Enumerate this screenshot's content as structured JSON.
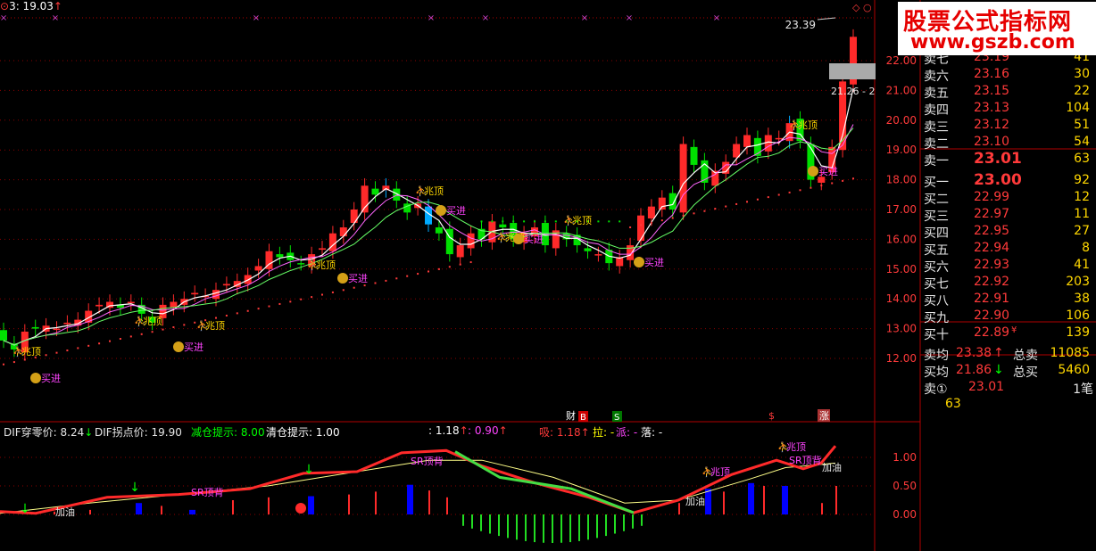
{
  "top": {
    "price_label": "3: 19.03",
    "up_arrow": "↑"
  },
  "chart": {
    "price_axis_labels": [
      "22.00",
      "21.00",
      "20.00",
      "19.00",
      "18.00",
      "17.00",
      "16.00",
      "15.00",
      "14.00",
      "13.00",
      "12.00"
    ],
    "osc_axis_labels": [
      "1.00",
      "0.50",
      "0.00"
    ],
    "high_label": "23.39",
    "range_label": "21.26 - 2",
    "markers": {
      "top": "兆顶",
      "buy": "买进",
      "add_oil": "加油",
      "sr_top": "SR顶背"
    },
    "event_labels": {
      "cai": "财",
      "b": "B",
      "s": "S",
      "dollar": "$",
      "zhang": "涨"
    }
  },
  "indicator": {
    "dif_zero_label": "DIF穿零价: 8.24",
    "dif_zero_arrow": "↓",
    "dif_turn_label": "DIF拐点价: 19.90",
    "reduce_label": "减仓提示: 8.00",
    "clear_label": "清仓提示: 1.00",
    "val1": ": 1.18",
    "val1_arrow": "↑",
    "val2": ": 0.90",
    "val2_arrow": "↑",
    "xi": "吸: 1.18",
    "xi_arrow": "↑",
    "la": "拉: -",
    "pai": "派: -",
    "luo": "落: -"
  },
  "watermark": {
    "title": "股票公式指标网",
    "url": "www.gszb.com"
  },
  "order_book": {
    "asks": [
      {
        "label": "卖七",
        "price": "23.19",
        "volume": "41"
      },
      {
        "label": "卖六",
        "price": "23.16",
        "volume": "30"
      },
      {
        "label": "卖五",
        "price": "23.15",
        "volume": "22"
      },
      {
        "label": "卖四",
        "price": "23.13",
        "volume": "104"
      },
      {
        "label": "卖三",
        "price": "23.12",
        "volume": "51"
      },
      {
        "label": "卖二",
        "price": "23.10",
        "volume": "54"
      },
      {
        "label": "卖一",
        "price": "23.01",
        "volume": "63"
      }
    ],
    "bids": [
      {
        "label": "买一",
        "price": "23.00",
        "volume": "92"
      },
      {
        "label": "买二",
        "price": "22.99",
        "volume": "12"
      },
      {
        "label": "买三",
        "price": "22.97",
        "volume": "11"
      },
      {
        "label": "买四",
        "price": "22.95",
        "volume": "27"
      },
      {
        "label": "买五",
        "price": "22.94",
        "volume": "8"
      },
      {
        "label": "买六",
        "price": "22.93",
        "volume": "41"
      },
      {
        "label": "买七",
        "price": "22.92",
        "volume": "203"
      },
      {
        "label": "买八",
        "price": "22.91",
        "volume": "38"
      },
      {
        "label": "买九",
        "price": "22.90",
        "volume": "106"
      },
      {
        "label": "买十",
        "price": "22.89",
        "volume": "139"
      }
    ],
    "bid10_flag": "¥",
    "ask_avg_label": "卖均",
    "ask_avg": "23.38",
    "ask_avg_arrow": "↑",
    "total_ask_label": "总卖",
    "total_ask": "11085",
    "bid_avg_label": "买均",
    "bid_avg": "21.86",
    "bid_avg_arrow": "↓",
    "total_bid_label": "总买",
    "total_bid": "5460",
    "sell1_queue_label": "卖①",
    "sell1_queue_price": "23.01",
    "sell1_queue_unit": "1笔",
    "sell1_queue_vol": "63"
  }
}
